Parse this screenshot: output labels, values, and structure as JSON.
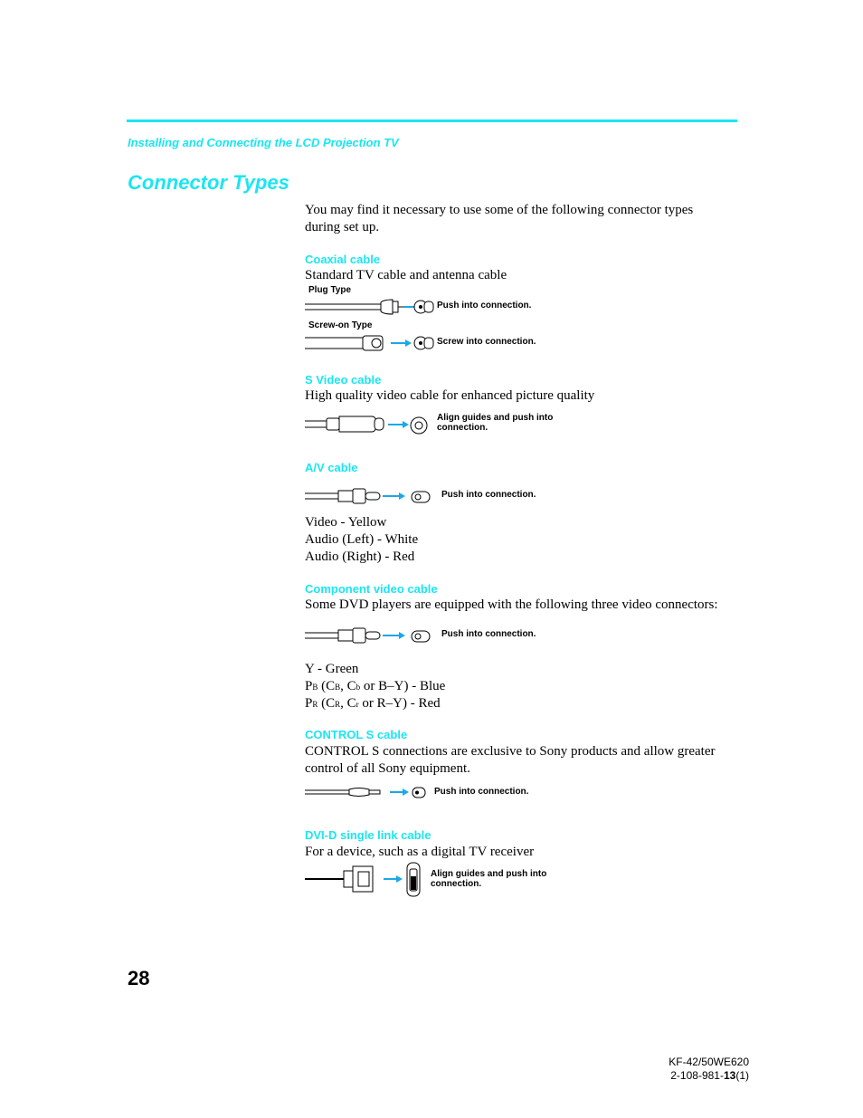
{
  "header": {
    "section": "Installing and Connecting the LCD Projection TV",
    "title": "Connector Types"
  },
  "intro": "You may find it necessary to use some of the following connector types during set up.",
  "sections": {
    "coaxial": {
      "heading": "Coaxial cable",
      "description": "Standard TV cable and antenna cable",
      "plug_label": "Plug Type",
      "plug_instruction": "Push into connection.",
      "screw_label": "Screw-on Type",
      "screw_instruction": "Screw into connection."
    },
    "svideo": {
      "heading": "S Video cable",
      "description": "High quality video cable for enhanced picture quality",
      "instruction_line1": "Align guides and push into",
      "instruction_line2": "connection."
    },
    "av": {
      "heading": "A/V cable",
      "instruction": "Push into connection.",
      "colors": [
        "Video - Yellow",
        "Audio (Left) - White",
        "Audio (Right) - Red"
      ]
    },
    "component": {
      "heading": "Component video cable",
      "description": "Some DVD players are equipped with the following three video connectors:",
      "instruction": "Push into connection.",
      "y_line": "Y - Green",
      "pb_prefix": "P",
      "pb_sub": "B",
      "pb_mid1": " (C",
      "pb_sub2": "B",
      "pb_mid2": ", C",
      "pb_sub3": "b",
      "pb_rest": " or B–Y) - Blue",
      "pr_prefix": "P",
      "pr_sub": "R",
      "pr_mid1": " (C",
      "pr_sub2": "R",
      "pr_mid2": ", C",
      "pr_sub3": "r",
      "pr_rest": " or R–Y) - Red"
    },
    "controls": {
      "heading": "CONTROL S cable",
      "description_line1": "CONTROL S connections are exclusive to Sony products and allow greater",
      "description_line2": "control of all Sony equipment.",
      "instruction": "Push into connection."
    },
    "dvi": {
      "heading": "DVI-D single link cable",
      "description": "For a device, such as a digital TV receiver",
      "instruction_line1": "Align guides and push into",
      "instruction_line2": "connection."
    }
  },
  "page_number": "28",
  "footer": {
    "model": "KF-42/50WE620",
    "code_prefix": "2-108-981-",
    "code_bold": "13",
    "code_suffix": "(1)"
  },
  "colors": {
    "accent": "#19e6f2",
    "arrow": "#1aa8e8"
  }
}
